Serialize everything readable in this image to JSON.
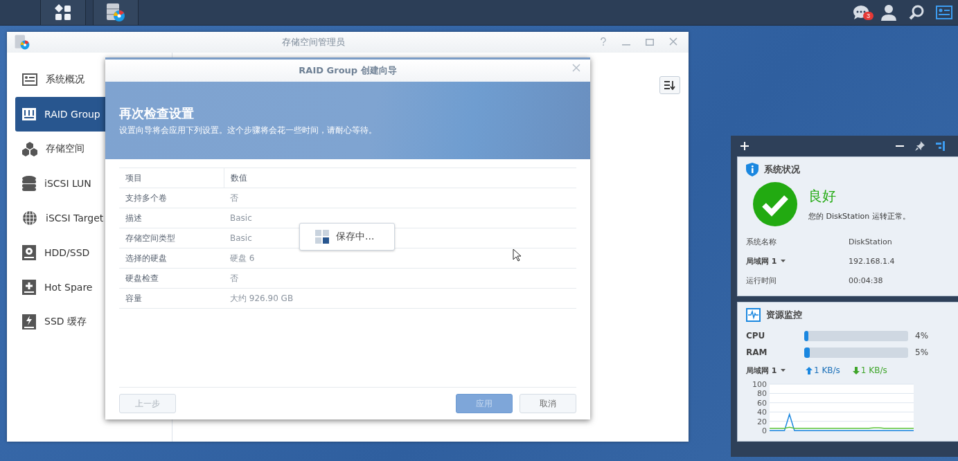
{
  "taskbar": {
    "notification_badge": "3"
  },
  "window": {
    "title": "存储空间管理员"
  },
  "sidebar": {
    "items": [
      {
        "label": "系统概况",
        "selected": false
      },
      {
        "label": "RAID Group",
        "selected": true
      },
      {
        "label": "存储空间",
        "selected": false
      },
      {
        "label": "iSCSI LUN",
        "selected": false
      },
      {
        "label": "iSCSI Target",
        "selected": false
      },
      {
        "label": "HDD/SSD",
        "selected": false
      },
      {
        "label": "Hot Spare",
        "selected": false
      },
      {
        "label": "SSD 缓存",
        "selected": false
      }
    ]
  },
  "dialog": {
    "title": "RAID Group 创建向导",
    "heading": "再次检查设置",
    "subheading": "设置向导将会应用下列设置。这个步骤将会花一些时间，请耐心等待。",
    "table": {
      "columns": [
        "项目",
        "数值"
      ],
      "rows": [
        [
          "支持多个卷",
          "否"
        ],
        [
          "描述",
          "Basic"
        ],
        [
          "存储空间类型",
          "Basic"
        ],
        [
          "选择的硬盘",
          "硬盘 6"
        ],
        [
          "硬盘检查",
          "否"
        ],
        [
          "容量",
          "大约 926.90 GB"
        ]
      ]
    },
    "buttons": [
      {
        "label": "上一步",
        "kind": "secondary",
        "disabled": true
      },
      {
        "label": "应用",
        "kind": "primary",
        "disabled": true
      },
      {
        "label": "取消",
        "kind": "secondary",
        "disabled": false
      }
    ],
    "saving": "保存中..."
  },
  "system_status": {
    "title": "系统状况",
    "status": "良好",
    "message": "您的 DiskStation 运转正常。",
    "rows": [
      {
        "label": "系统名称",
        "value": "DiskStation",
        "kind": "plain"
      },
      {
        "label": "局域网 1",
        "value": "192.168.1.4",
        "kind": "dropdown"
      },
      {
        "label": "运行时间",
        "value": "00:04:38",
        "kind": "plain"
      }
    ]
  },
  "resource_monitor": {
    "title": "资源监控",
    "meters": [
      {
        "name": "CPU",
        "level": 0.04,
        "reading": "4%"
      },
      {
        "name": "RAM",
        "level": 0.05,
        "reading": "5%"
      }
    ],
    "network": {
      "label": "局域网 1",
      "upload": "1 KB/s",
      "download": "1 KB/s"
    },
    "chart_data": {
      "type": "line",
      "grid": true,
      "ylim": [
        0,
        100
      ],
      "yticks": [
        0,
        20,
        40,
        60,
        80,
        100
      ],
      "series": [
        {
          "color": "#1a87e0",
          "values": [
            0,
            0,
            0,
            0,
            35,
            0,
            0,
            0,
            0,
            0,
            0,
            0,
            0,
            0,
            0,
            0,
            0,
            0,
            0,
            0,
            0,
            0,
            0,
            0,
            0,
            0,
            0,
            0,
            0,
            0
          ]
        },
        {
          "color": "#5cc43a",
          "values": [
            5,
            5,
            5,
            5,
            7,
            5,
            5,
            5,
            5,
            5,
            5,
            5,
            5,
            5,
            5,
            5,
            5,
            5,
            5,
            5,
            5,
            6,
            6,
            5,
            5,
            5,
            5,
            5,
            5,
            5
          ]
        }
      ]
    }
  }
}
